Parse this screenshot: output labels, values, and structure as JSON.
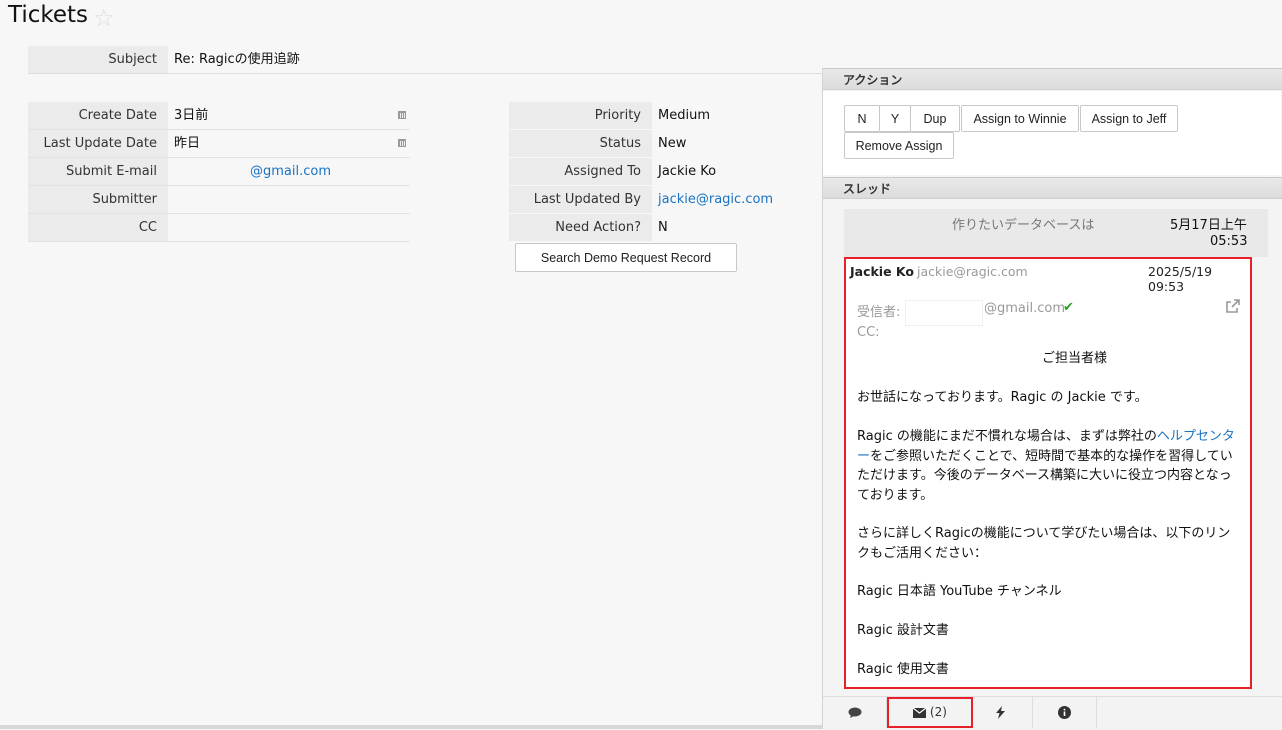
{
  "page": {
    "title": "Tickets"
  },
  "form": {
    "subject_label": "Subject",
    "subject_value": "Re: Ragicの使用追跡",
    "left_fields": [
      {
        "label": "Create Date",
        "value": "3日前"
      },
      {
        "label": "Last Update Date",
        "value": "昨日"
      },
      {
        "label": "Submit E-mail",
        "value": "@gmail.com"
      },
      {
        "label": "Submitter",
        "value": ""
      },
      {
        "label": "CC",
        "value": ""
      }
    ],
    "right_fields": [
      {
        "label": "Priority",
        "value": "Medium"
      },
      {
        "label": "Status",
        "value": "New"
      },
      {
        "label": "Assigned To",
        "value": "Jackie Ko"
      },
      {
        "label": "Last Updated By",
        "value": "jackie@ragic.com"
      },
      {
        "label": "Need Action?",
        "value": "N"
      }
    ],
    "search_button": "Search Demo Request Record"
  },
  "actions": {
    "header": "アクション",
    "buttons": [
      "N",
      "Y",
      "Dup",
      "Assign to Winnie",
      "Assign to Jeff",
      "Remove Assign"
    ]
  },
  "thread": {
    "header": "スレッド",
    "prev_subject": "作りたいデータベースは",
    "prev_date": "5月17日上午",
    "prev_time": "05:53",
    "mail": {
      "sender_name": "Jackie Ko",
      "sender_email": "jackie@ragic.com",
      "date": "2025/5/19 09:53",
      "to_label": "受信者:",
      "to_value": "@gmail.com",
      "cc_label": "CC:",
      "greeting": "ご担当者様",
      "p1": "お世話になっております。Ragic の Jackie です。",
      "p2_a": "Ragic の機能にまだ不慣れな場合は、まずは弊社の",
      "p2_link_a": "ヘルプセンタ",
      "p2_link_b": "ー",
      "p2_b": "をご参照いただくことで、短時間で基本的な操作を習得していただけます。今後のデータベース構築に大いに役立つ内容となっております。",
      "p3": "さらに詳しくRagicの機能について学びたい場合は、以下のリンクもご活用ください：",
      "links": [
        "Ragic 日本語 YouTube チャンネル",
        "Ragic 設計文書",
        "Ragic 使用文書"
      ]
    }
  },
  "tabs": {
    "mail_count": "(2)"
  }
}
